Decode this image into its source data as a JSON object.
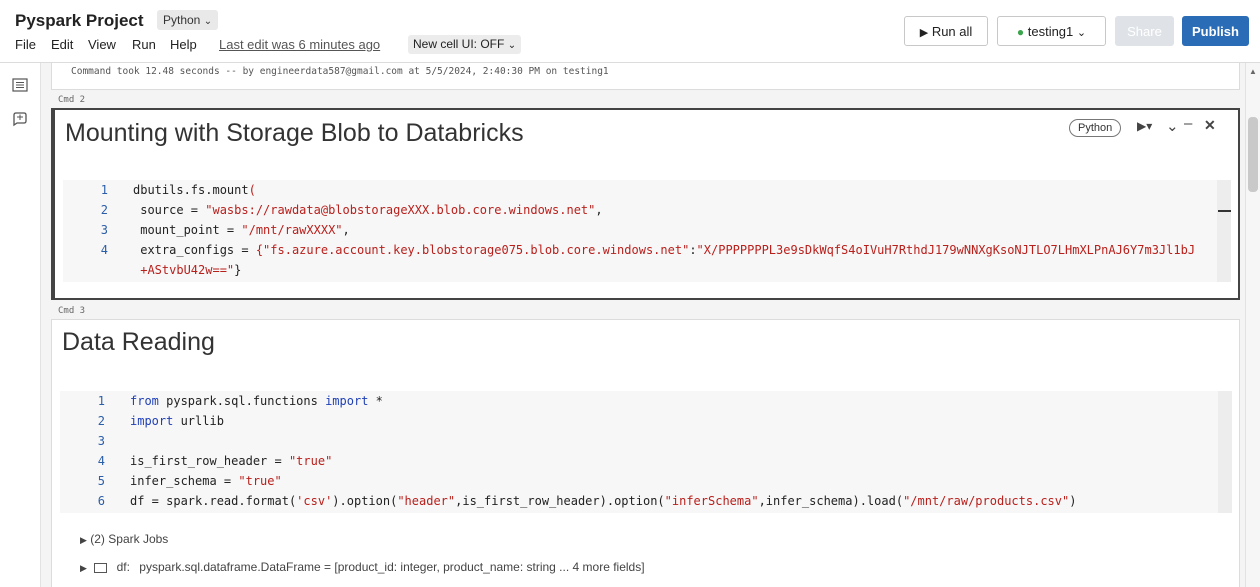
{
  "header": {
    "title": "Pyspark Project",
    "language": "Python",
    "menu": [
      "File",
      "Edit",
      "View",
      "Run",
      "Help"
    ],
    "last_edit": "Last edit was 6 minutes ago",
    "new_cell_ui": "New cell UI: OFF",
    "run_all": "Run all",
    "cluster": "testing1",
    "share": "Share",
    "publish": "Publish"
  },
  "cell1": {
    "output": "Command took 12.48 seconds -- by engineerdata587@gmail.com at 5/5/2024, 2:40:30 PM on testing1"
  },
  "cell2": {
    "cmd": "Cmd 2",
    "title": "Mounting with Storage Blob to Databricks",
    "language": "Python",
    "lines": [
      {
        "n": "1",
        "parts": [
          [
            "fn",
            "dbutils.fs.mount"
          ],
          [
            "st",
            "("
          ]
        ]
      },
      {
        "n": "2",
        "parts": [
          [
            "fn",
            " source = "
          ],
          [
            "st",
            "\"wasbs://rawdata@blobstorageXXX.blob.core.windows.net\""
          ],
          [
            "fn",
            ","
          ]
        ]
      },
      {
        "n": "3",
        "parts": [
          [
            "fn",
            " mount_point = "
          ],
          [
            "st",
            "\"/mnt/rawXXXX\""
          ],
          [
            "fn",
            ","
          ]
        ]
      },
      {
        "n": "4",
        "parts": [
          [
            "fn",
            " extra_configs = "
          ],
          [
            "st",
            "{\"fs.azure.account.key.blobstorage075.blob.core.windows.net\""
          ],
          [
            "fn",
            ":"
          ],
          [
            "st",
            "\"X/PPPPPPPL3e9sDkWqfS4oIVuH7RthdJ179wNNXgKsoNJTLO7LHmXLPnAJ6Y7m3Jl1bJ"
          ]
        ]
      },
      {
        "n": "",
        "parts": [
          [
            "st",
            " +AStvbU42w==\""
          ],
          [
            "fn",
            "}"
          ]
        ]
      }
    ]
  },
  "cell3": {
    "cmd": "Cmd 3",
    "title": "Data Reading",
    "lines": [
      {
        "n": "1",
        "parts": [
          [
            "kw",
            "from"
          ],
          [
            "fn",
            " pyspark.sql.functions "
          ],
          [
            "kw",
            "import"
          ],
          [
            "fn",
            " *"
          ]
        ]
      },
      {
        "n": "2",
        "parts": [
          [
            "kw",
            "import"
          ],
          [
            "fn",
            " urllib"
          ]
        ]
      },
      {
        "n": "3",
        "parts": []
      },
      {
        "n": "4",
        "parts": [
          [
            "fn",
            "is_first_row_header = "
          ],
          [
            "st",
            "\"true\""
          ]
        ]
      },
      {
        "n": "5",
        "parts": [
          [
            "fn",
            "infer_schema = "
          ],
          [
            "st",
            "\"true\""
          ]
        ]
      },
      {
        "n": "6",
        "parts": [
          [
            "fn",
            "df = spark.read.format("
          ],
          [
            "st",
            "'csv'"
          ],
          [
            "fn",
            ").option("
          ],
          [
            "st",
            "\"header\""
          ],
          [
            "fn",
            ",is_first_row_header).option("
          ],
          [
            "st",
            "\"inferSchema\""
          ],
          [
            "fn",
            ",infer_schema).load("
          ],
          [
            "st",
            "\"/mnt/raw/products.csv\""
          ],
          [
            "fn",
            ")"
          ]
        ]
      }
    ],
    "spark_jobs": "(2) Spark Jobs",
    "df_label": "df:",
    "df_schema": "pyspark.sql.dataframe.DataFrame = [product_id: integer, product_name: string ... 4 more fields]"
  }
}
